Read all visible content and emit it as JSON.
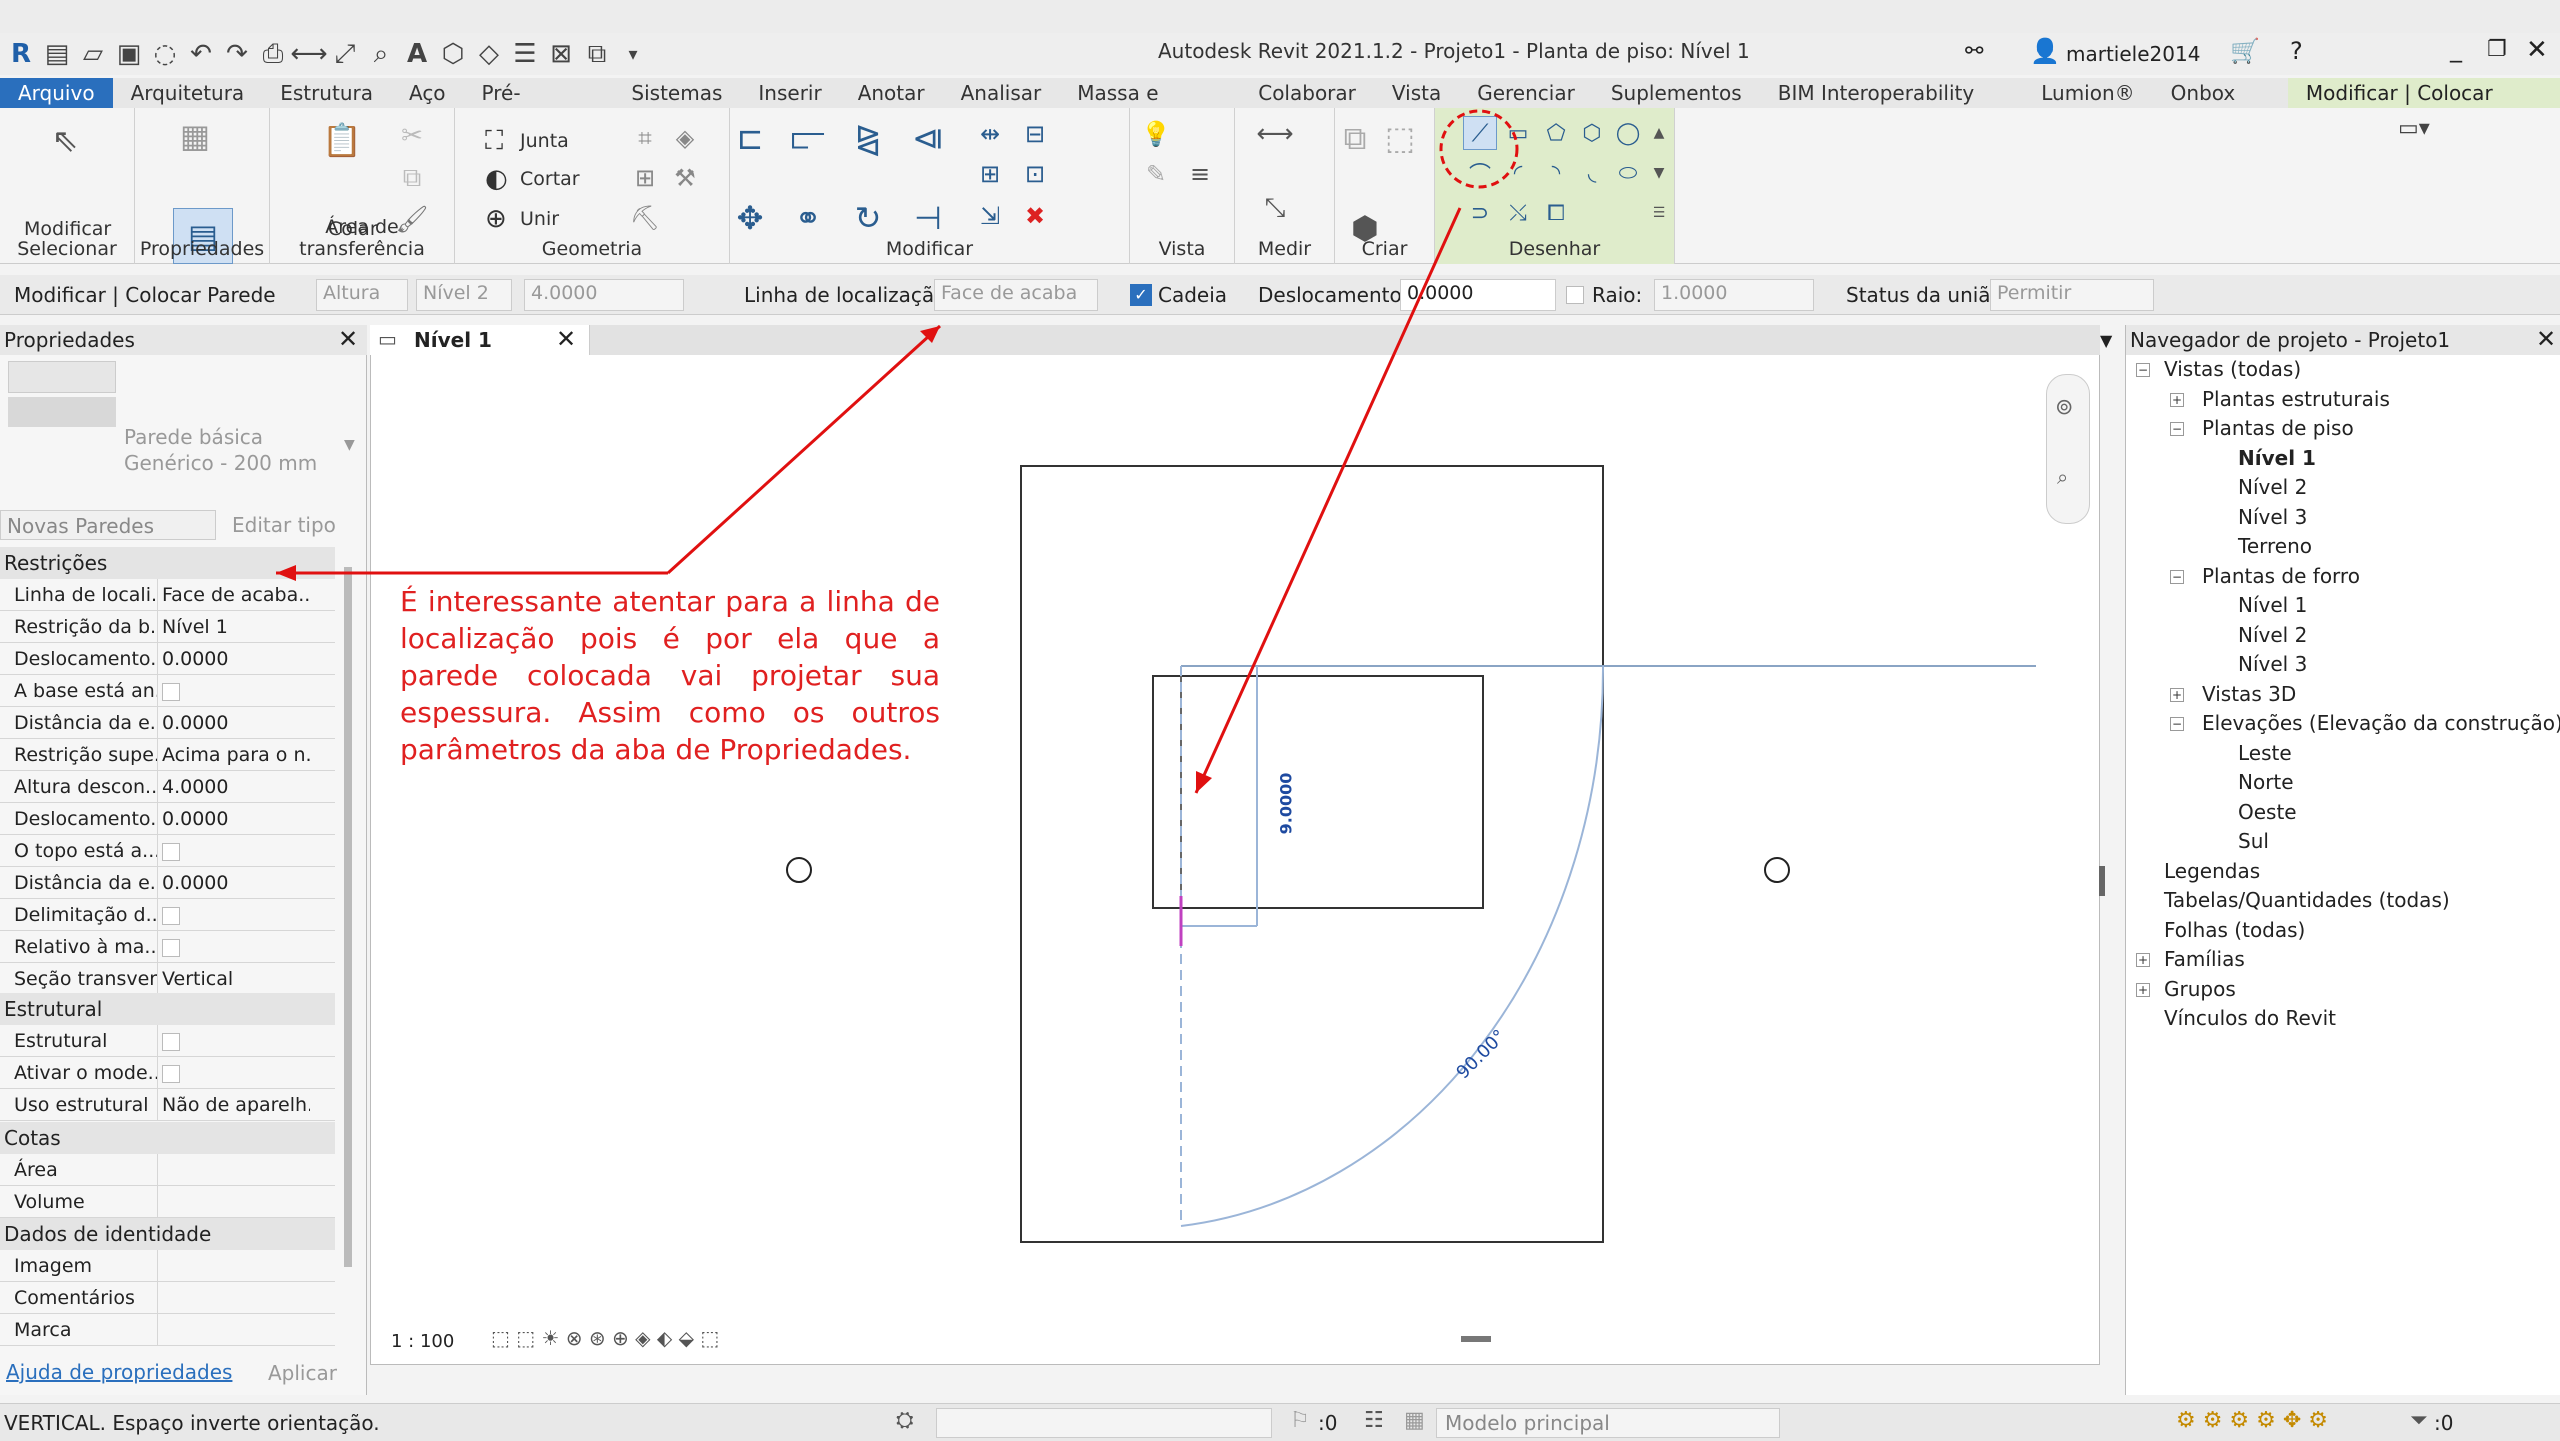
{
  "window": {
    "title": "Autodesk Revit 2021.1.2 - Projeto1 - Planta de piso: Nível 1",
    "user": "martiele2014"
  },
  "menu_tabs": [
    "Arquivo",
    "Arquitetura",
    "Estrutura",
    "Aço",
    "Pré-moldado",
    "Sistemas",
    "Inserir",
    "Anotar",
    "Analisar",
    "Massa e terreno",
    "Colaborar",
    "Vista",
    "Gerenciar",
    "Suplementos",
    "BIM Interoperability Tools",
    "Lumion®",
    "Onbox App",
    "Modificar | Colocar Parede"
  ],
  "ribbon": {
    "modify_label": "Modificar",
    "paste_label": "Colar",
    "join_label": "Junta",
    "cut_label": "Cortar",
    "unite_label": "Unir",
    "panels": [
      "Selecionar",
      "Propriedades",
      "Área de transferência",
      "Geometria",
      "Modificar",
      "Vista",
      "Medir",
      "Criar",
      "Desenhar"
    ]
  },
  "options_bar": {
    "context": "Modificar | Colocar Parede",
    "height_label": "Altura",
    "level_value": "Nível 2",
    "height_value": "4.0000",
    "location_line_label": "Linha de localização:",
    "location_line_value": "Face de acaba",
    "chain_label": "Cadeia",
    "offset_label": "Deslocamento:",
    "offset_value": "0.0000",
    "radius_label": "Raio:",
    "radius_value": "1.0000",
    "join_status_label": "Status da união:",
    "join_status_value": "Permitir"
  },
  "properties": {
    "header": "Propriedades",
    "type_name": "Parede básica",
    "type_sub": "Genérico - 200 mm",
    "new_walls": "Novas Paredes",
    "edit_type": "Editar tipo",
    "sections": {
      "constraints": "Restrições",
      "structural": "Estrutural",
      "dimensions": "Cotas",
      "identity": "Dados de identidade"
    },
    "constraint_rows": [
      {
        "k": "Linha de locali...",
        "v": "Face de acaba..."
      },
      {
        "k": "Restrição da b...",
        "v": "Nível 1"
      },
      {
        "k": "Deslocamento...",
        "v": "0.0000"
      },
      {
        "k": "A base está an...",
        "v": ""
      },
      {
        "k": "Distância da e...",
        "v": "0.0000"
      },
      {
        "k": "Restrição supe...",
        "v": "Acima para o n..."
      },
      {
        "k": "Altura descon...",
        "v": "4.0000"
      },
      {
        "k": "Deslocamento...",
        "v": "0.0000"
      },
      {
        "k": "O topo está a...",
        "v": ""
      },
      {
        "k": "Distância da e...",
        "v": "0.0000"
      },
      {
        "k": "Delimitação d...",
        "v": ""
      },
      {
        "k": "Relativo à ma...",
        "v": ""
      },
      {
        "k": "Seção transver...",
        "v": "Vertical"
      }
    ],
    "structural_rows": [
      {
        "k": "Estrutural",
        "v": ""
      },
      {
        "k": "Ativar o mode...",
        "v": ""
      },
      {
        "k": "Uso estrutural",
        "v": "Não de aparelh..."
      }
    ],
    "dim_rows": [
      {
        "k": "Área",
        "v": ""
      },
      {
        "k": "Volume",
        "v": ""
      }
    ],
    "identity_rows": [
      {
        "k": "Imagem",
        "v": ""
      },
      {
        "k": "Comentários",
        "v": ""
      },
      {
        "k": "Marca",
        "v": ""
      }
    ],
    "help_link": "Ajuda de propriedades",
    "apply": "Aplicar"
  },
  "view": {
    "tab": "Nível 1",
    "scale": "1 : 100",
    "dimension_text": "9.0000",
    "angle_text": "90.00°"
  },
  "annotation": "É interessante atentar para a linha de localização pois é por ela que a parede colocada vai projetar sua espessura. Assim como os outros parâmetros da aba de Propriedades.",
  "browser": {
    "header": "Navegador de projeto - Projeto1",
    "items": [
      "Vistas (todas)",
      "Plantas estruturais",
      "Plantas de piso",
      "Nível 1",
      "Nível 2",
      "Nível 3",
      "Terreno",
      "Plantas de forro",
      "Nível 1",
      "Nível 2",
      "Nível 3",
      "Vistas 3D",
      "Elevações (Elevação da construção)",
      "Leste",
      "Norte",
      "Oeste",
      "Sul",
      "Legendas",
      "Tabelas/Quantidades (todas)",
      "Folhas (todas)",
      "Famílias",
      "Grupos",
      "Vínculos do Revit"
    ]
  },
  "status": {
    "message": "VERTICAL. Espaço inverte orientação.",
    "counter": ":0",
    "model": "Modelo principal",
    "filter": ":0"
  }
}
